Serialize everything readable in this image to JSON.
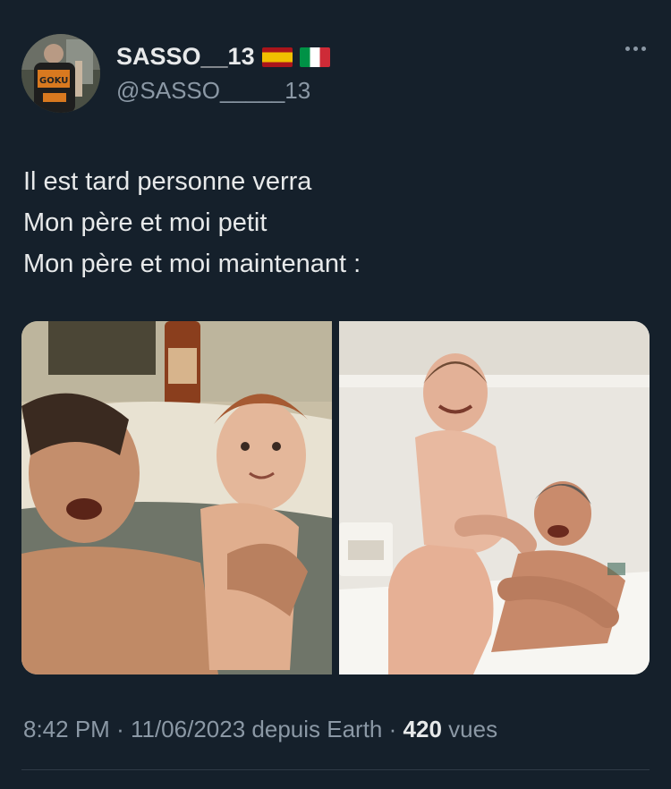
{
  "author": {
    "display_name": "SASSO__13",
    "handle": "@SASSO_____13",
    "flags": [
      "spain-flag",
      "italy-flag"
    ]
  },
  "tweet": {
    "lines": [
      "Il est tard personne verra",
      "Mon père et moi petit",
      "Mon père et moi maintenant :"
    ]
  },
  "media": {
    "images": [
      "photo-father-son-past",
      "photo-father-son-now"
    ]
  },
  "footer": {
    "time": "8:42 PM",
    "date": "11/06/2023",
    "source": "depuis Earth",
    "separator": "·",
    "views_count": "420",
    "views_label": "vues"
  },
  "colors": {
    "background": "#15202b",
    "text_primary": "#e7e9ea",
    "text_secondary": "#8b98a5"
  }
}
